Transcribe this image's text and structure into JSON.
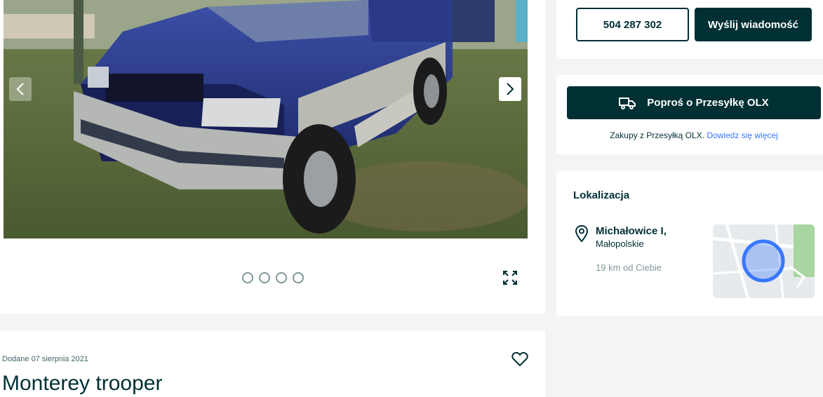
{
  "gallery": {
    "photo_alt": "Isuzu Trooper niebieski",
    "prev_icon": "chevron-left-icon",
    "next_icon": "chevron-right-icon",
    "dot_count": 4,
    "expand_icon": "expand-icon"
  },
  "ad": {
    "date": "Dodane 07 sierpnia 2021",
    "title": "Monterey trooper",
    "favorite_icon": "heart-icon"
  },
  "contact": {
    "phone": "504 287 302",
    "message_label": "Wyślij wiadomość"
  },
  "delivery": {
    "button_label": "Poproś o Przesyłkę OLX",
    "icon": "truck-icon",
    "note_prefix": "Zakupy z Przesyłką OLX. ",
    "note_link": "Dowiedz się więcej"
  },
  "location": {
    "heading": "Lokalizacja",
    "city": "Michałowice I,",
    "region": "Małopolskie",
    "distance": "19 km od Ciebie",
    "pin_icon": "location-pin-icon"
  },
  "colors": {
    "brand_dark": "#002f34",
    "link_blue": "#3a77ff",
    "map_circle": "#3a77ff"
  }
}
